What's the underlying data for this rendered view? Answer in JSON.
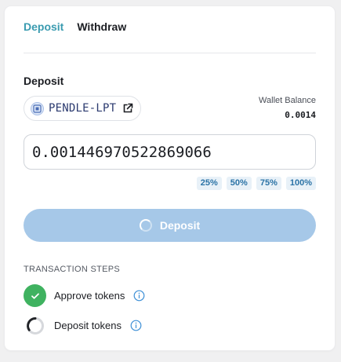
{
  "tabs": [
    {
      "label": "Deposit",
      "active": true
    },
    {
      "label": "Withdraw",
      "active": false
    }
  ],
  "section_label": "Deposit",
  "token": {
    "name": "PENDLE-LPT",
    "icon": "pendle-token-icon",
    "link_icon": "external-link-icon"
  },
  "wallet": {
    "label": "Wallet Balance",
    "value": "0.0014"
  },
  "amount_input": {
    "value": "0.001446970522869066"
  },
  "percent_buttons": [
    "25%",
    "50%",
    "75%",
    "100%"
  ],
  "deposit_button": {
    "label": "Deposit",
    "state": "loading",
    "color": "#a6c8e8"
  },
  "steps": {
    "title": "TRANSACTION STEPS",
    "items": [
      {
        "label": "Approve tokens",
        "status": "complete",
        "color": "#3fb260"
      },
      {
        "label": "Deposit tokens",
        "status": "pending"
      }
    ]
  },
  "colors": {
    "accent": "#3a9bb0",
    "token_text": "#2b3a6f",
    "pct_bg": "#e8f1f8",
    "pct_text": "#2b73a6"
  }
}
